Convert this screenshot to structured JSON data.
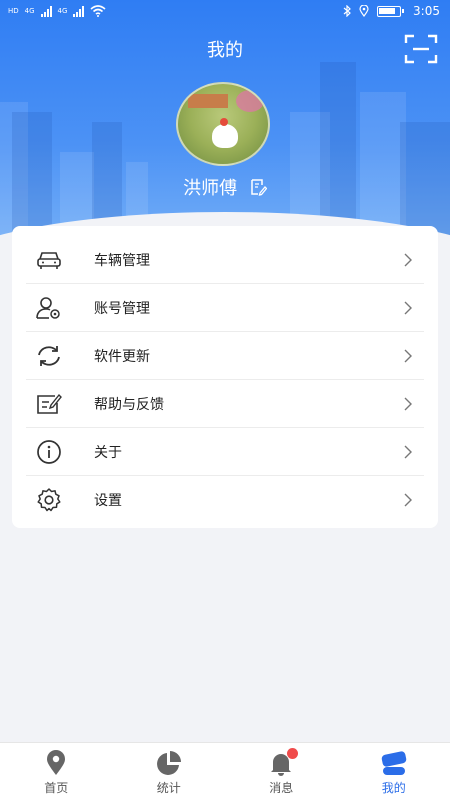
{
  "status_bar": {
    "network_a": "4G",
    "network_b": "4G",
    "hd_a": "HD",
    "hd_b": "HD",
    "time": "3:05"
  },
  "header": {
    "title": "我的"
  },
  "profile": {
    "name": "洪师傅"
  },
  "menu": [
    {
      "label": "车辆管理",
      "icon": "car-icon"
    },
    {
      "label": "账号管理",
      "icon": "account-settings-icon"
    },
    {
      "label": "软件更新",
      "icon": "refresh-icon"
    },
    {
      "label": "帮助与反馈",
      "icon": "feedback-icon"
    },
    {
      "label": "关于",
      "icon": "info-icon"
    },
    {
      "label": "设置",
      "icon": "gear-icon"
    }
  ],
  "tabbar": [
    {
      "label": "首页",
      "icon": "location-pin-icon",
      "active": false
    },
    {
      "label": "统计",
      "icon": "pie-chart-icon",
      "active": false
    },
    {
      "label": "消息",
      "icon": "bell-icon",
      "active": false
    },
    {
      "label": "我的",
      "icon": "person-icon",
      "active": true
    }
  ],
  "colors": {
    "accent": "#2b6de8",
    "header_top": "#2f7df3",
    "badge": "#f04b4b"
  }
}
